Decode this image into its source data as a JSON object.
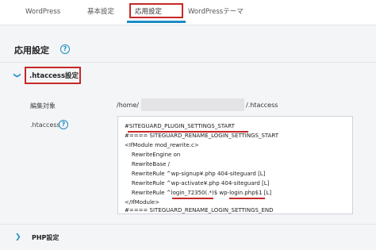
{
  "tabs": [
    {
      "label": "WordPress"
    },
    {
      "label": "基本設定"
    },
    {
      "label": "応用設定"
    },
    {
      "label": "WordPressテーマ"
    }
  ],
  "page": {
    "title": "応用設定",
    "help_glyph": "?"
  },
  "section_htaccess": {
    "title": ".htaccess設定",
    "edit_target_label": "編集対象",
    "path_prefix": "/home/",
    "path_suffix": "/.htaccess",
    "htaccess_label": ".htaccess",
    "help_glyph": "?",
    "code_lines": [
      "#SITEGUARD_PLUGIN_SETTINGS_START",
      "#==== SITEGUARD_RENAME_LOGIN_SETTINGS_START",
      "<IfModule mod_rewrite.c>",
      "    RewriteEngine on",
      "    RewriteBase /",
      "    RewriteRule ^wp-signup¥.php 404-siteguard [L]",
      "    RewriteRule ^wp-activate¥.php 404-siteguard [L]",
      "    RewriteRule ^login_72350(.*)$ wp-login.php$1 [L]",
      "</IfModule>",
      "#==== SITEGUARD_RENAME_LOGIN_SETTINGS_END"
    ]
  },
  "section_php": {
    "title": "PHP設定"
  },
  "colors": {
    "accent": "#1d8bc7",
    "highlight": "#c62828"
  }
}
